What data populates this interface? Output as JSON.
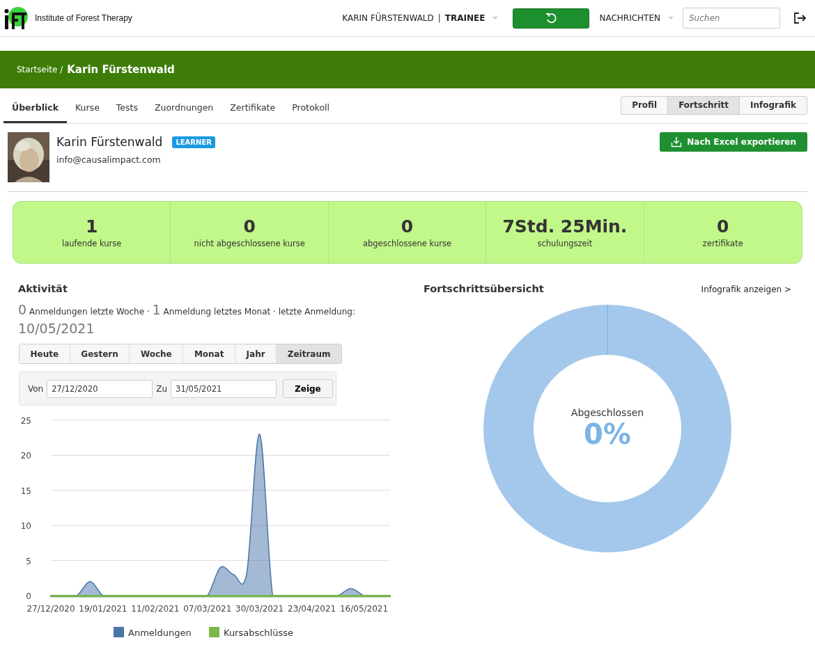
{
  "header": {
    "brand": "Institute of Forest Therapy",
    "user": {
      "name": "KARIN FÜRSTENWALD",
      "separator": "|",
      "role": "TRAINEE"
    },
    "messages": "NACHRICHTEN",
    "search": {
      "placeholder": "Suchen"
    }
  },
  "banner": {
    "breadcrumb": "Startseite /",
    "title": "Karin Fürstenwald"
  },
  "tabs": [
    {
      "label": "Überblick",
      "selected": true
    },
    {
      "label": "Kurse",
      "selected": false
    },
    {
      "label": "Tests",
      "selected": false
    },
    {
      "label": "Zuordnungen",
      "selected": false
    },
    {
      "label": "Zertifikate",
      "selected": false
    },
    {
      "label": "Protokoll",
      "selected": false
    }
  ],
  "view_buttons": [
    {
      "label": "Profil",
      "selected": false
    },
    {
      "label": "Fortschritt",
      "selected": true
    },
    {
      "label": "Infografik",
      "selected": false
    }
  ],
  "profile": {
    "name": "Karin Fürstenwald",
    "badge": "LEARNER",
    "email": "info@causalimpact.com",
    "export_button": "Nach Excel exportieren"
  },
  "stats": [
    {
      "value": "1",
      "label": "laufende kurse"
    },
    {
      "value": "0",
      "label": "nicht abgeschlossene kurse"
    },
    {
      "value": "0",
      "label": "abgeschlossene kurse"
    },
    {
      "value": "7Std. 25Min.",
      "label": "schulungszeit"
    },
    {
      "value": "0",
      "label": "zertifikate"
    }
  ],
  "activity": {
    "title": "Aktivität",
    "summary": [
      {
        "kind": "count",
        "text": "0"
      },
      {
        "kind": "label",
        "text": "Anmeldungen letzte Woche ·"
      },
      {
        "kind": "count",
        "text": "1"
      },
      {
        "kind": "label",
        "text": "Anmeldung letztes Monat · letzte Anmeldung:"
      },
      {
        "kind": "count",
        "text": "10/05/2021"
      }
    ],
    "periods": [
      {
        "label": "Heute",
        "selected": false
      },
      {
        "label": "Gestern",
        "selected": false
      },
      {
        "label": "Woche",
        "selected": false
      },
      {
        "label": "Monat",
        "selected": false
      },
      {
        "label": "Jahr",
        "selected": false
      },
      {
        "label": "Zeitraum",
        "selected": true
      }
    ],
    "range": {
      "from_label": "Von",
      "from": "27/12/2020",
      "to_label": "Zu",
      "to": "31/05/2021",
      "button": "Zeige"
    },
    "chart_data": {
      "type": "area",
      "grid": true,
      "legend": "bottom",
      "categories": [
        "27/12/2020",
        null,
        null,
        null,
        "19/01/2021",
        null,
        null,
        null,
        "11/02/2021",
        null,
        null,
        null,
        "07/03/2021",
        null,
        null,
        null,
        "30/03/2021",
        null,
        null,
        null,
        "23/04/2021",
        null,
        null,
        null,
        "16/05/2021",
        null,
        null
      ],
      "yticks": [
        0,
        5,
        10,
        15,
        20,
        25
      ],
      "ylim": [
        0,
        25
      ],
      "series": [
        {
          "name": "Anmeldungen",
          "color": "#4a74a8",
          "values": [
            0,
            0,
            0,
            2,
            0,
            0,
            0,
            0,
            0,
            0,
            0,
            0,
            0,
            4,
            3,
            3,
            23,
            0,
            0,
            0,
            0,
            0,
            0,
            1,
            0,
            0,
            0
          ]
        },
        {
          "name": "Kursabschlüsse",
          "color": "#7ab648",
          "values": [
            0,
            0,
            0,
            0,
            0,
            0,
            0,
            0,
            0,
            0,
            0,
            0,
            0,
            0,
            0,
            0,
            0,
            0,
            0,
            0,
            0,
            0,
            0,
            0,
            0,
            0,
            0
          ]
        }
      ]
    }
  },
  "progress": {
    "title": "Fortschrittsübersicht",
    "link": "Infografik anzeigen >",
    "donut": {
      "label": "Abgeschlossen",
      "value": "0%",
      "level": 0
    }
  }
}
